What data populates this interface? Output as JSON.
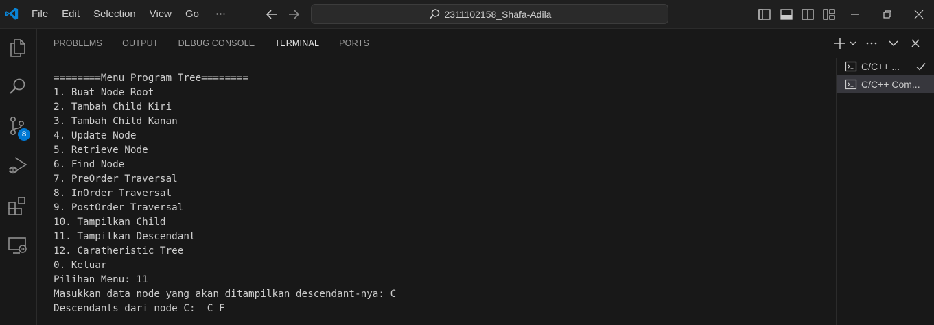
{
  "menu": [
    "File",
    "Edit",
    "Selection",
    "View",
    "Go",
    "⋯"
  ],
  "search": {
    "text": "2311102158_Shafa-Adila"
  },
  "activity": {
    "source_control_badge": "8"
  },
  "panel": {
    "tabs": [
      "PROBLEMS",
      "OUTPUT",
      "DEBUG CONSOLE",
      "TERMINAL",
      "PORTS"
    ],
    "active_tab": "TERMINAL"
  },
  "terminal": {
    "lines": [
      "========Menu Program Tree========",
      "1. Buat Node Root",
      "2. Tambah Child Kiri",
      "3. Tambah Child Kanan",
      "4. Update Node",
      "5. Retrieve Node",
      "6. Find Node",
      "7. PreOrder Traversal",
      "8. InOrder Traversal",
      "9. PostOrder Traversal",
      "10. Tampilkan Child",
      "11. Tampilkan Descendant",
      "12. Caratheristic Tree",
      "0. Keluar",
      "Pilihan Menu: 11",
      "Masukkan data node yang akan ditampilkan descendant-nya: C",
      "Descendants dari node C:  C F"
    ]
  },
  "terminal_list": [
    {
      "label": "C/C++ ...",
      "icon": "terminal-icon",
      "status": "check-icon",
      "active": false
    },
    {
      "label": "C/C++ Com...",
      "icon": "terminal-icon",
      "status": "",
      "active": true
    }
  ],
  "colors": {
    "accent": "#0078d4",
    "background": "#181818",
    "titlebar": "#1f1f1f",
    "text": "#cccccc"
  }
}
